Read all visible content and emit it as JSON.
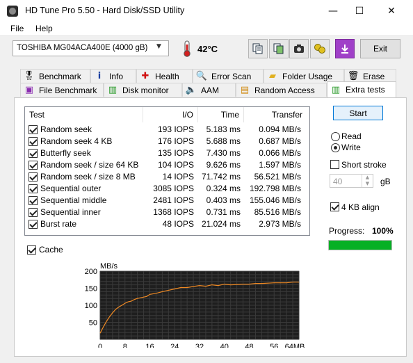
{
  "window": {
    "title": "HD Tune Pro 5.50 - Hard Disk/SSD Utility",
    "minimize": "—",
    "maximize": "☐",
    "close": "✕"
  },
  "menu": {
    "file": "File",
    "help": "Help"
  },
  "toolbar": {
    "drive": "TOSHIBA MG04ACA400E (4000 gB)",
    "temperature": "42°C",
    "exit_label": "Exit",
    "icons": [
      "copy-info-icon",
      "copy-screenshot-icon",
      "camera-icon",
      "options-icon",
      "save-download-icon"
    ]
  },
  "tabs_row1": [
    {
      "label": "Benchmark",
      "icon": "benchmark-icon"
    },
    {
      "label": "Info",
      "icon": "info-icon"
    },
    {
      "label": "Health",
      "icon": "health-icon"
    },
    {
      "label": "Error Scan",
      "icon": "error-scan-icon"
    },
    {
      "label": "Folder Usage",
      "icon": "folder-icon"
    },
    {
      "label": "Erase",
      "icon": "trash-icon"
    }
  ],
  "tabs_row2": [
    {
      "label": "File Benchmark",
      "icon": "file-benchmark-icon"
    },
    {
      "label": "Disk monitor",
      "icon": "disk-monitor-icon"
    },
    {
      "label": "AAM",
      "icon": "speaker-icon"
    },
    {
      "label": "Random Access",
      "icon": "random-access-icon"
    },
    {
      "label": "Extra tests",
      "icon": "extra-tests-icon",
      "selected": true
    }
  ],
  "table": {
    "headers": {
      "test": "Test",
      "io": "I/O",
      "time": "Time",
      "transfer": "Transfer"
    },
    "rows": [
      {
        "test": "Random seek",
        "io": "193 IOPS",
        "time": "5.183 ms",
        "transfer": "0.094 MB/s",
        "checked": true
      },
      {
        "test": "Random seek 4 KB",
        "io": "176 IOPS",
        "time": "5.688 ms",
        "transfer": "0.687 MB/s",
        "checked": true
      },
      {
        "test": "Butterfly seek",
        "io": "135 IOPS",
        "time": "7.430 ms",
        "transfer": "0.066 MB/s",
        "checked": true
      },
      {
        "test": "Random seek / size 64 KB",
        "io": "104 IOPS",
        "time": "9.626 ms",
        "transfer": "1.597 MB/s",
        "checked": true
      },
      {
        "test": "Random seek / size 8 MB",
        "io": "14 IOPS",
        "time": "71.742 ms",
        "transfer": "56.521 MB/s",
        "checked": true
      },
      {
        "test": "Sequential outer",
        "io": "3085 IOPS",
        "time": "0.324 ms",
        "transfer": "192.798 MB/s",
        "checked": true
      },
      {
        "test": "Sequential middle",
        "io": "2481 IOPS",
        "time": "0.403 ms",
        "transfer": "155.046 MB/s",
        "checked": true
      },
      {
        "test": "Sequential inner",
        "io": "1368 IOPS",
        "time": "0.731 ms",
        "transfer": "85.516 MB/s",
        "checked": true
      },
      {
        "test": "Burst rate",
        "io": "48 IOPS",
        "time": "21.024 ms",
        "transfer": "2.973 MB/s",
        "checked": true
      }
    ]
  },
  "options": {
    "cache": "Cache",
    "cache_checked": true,
    "start": "Start",
    "read": "Read",
    "write": "Write",
    "mode": "write",
    "short_stroke": "Short stroke",
    "short_stroke_checked": false,
    "stroke_size": "40",
    "stroke_unit": "gB",
    "align": "4 KB align",
    "align_checked": true
  },
  "progress": {
    "label": "Progress:",
    "value_text": "100%",
    "fraction": 1.0
  },
  "chart_data": {
    "type": "line",
    "ylabel": "MB/s",
    "ylim": [
      0,
      200
    ],
    "yticks": [
      "200",
      "150",
      "100",
      "50"
    ],
    "xticks": [
      "0",
      "8",
      "16",
      "24",
      "32",
      "40",
      "48",
      "56",
      "64MB"
    ],
    "xlim": [
      0,
      64
    ],
    "grid": true,
    "background": "#1e1e1e",
    "line_color": "#f08a24",
    "series": [
      {
        "x": [
          0,
          1,
          2,
          3,
          4,
          5,
          6,
          7,
          8,
          9,
          10,
          11,
          12,
          13,
          14,
          15,
          16,
          18,
          20,
          22,
          24,
          26,
          28,
          30,
          32,
          34,
          36,
          38,
          40,
          42,
          44,
          46,
          48,
          50,
          52,
          54,
          56,
          58,
          60,
          62,
          64
        ],
        "values": [
          18,
          36,
          52,
          66,
          78,
          88,
          95,
          100,
          106,
          110,
          112,
          117,
          120,
          122,
          124,
          126,
          132,
          135,
          140,
          144,
          148,
          152,
          152,
          155,
          158,
          156,
          160,
          158,
          162,
          160,
          161,
          162,
          162,
          164,
          164,
          165,
          166,
          166,
          166,
          168,
          168
        ]
      }
    ]
  }
}
